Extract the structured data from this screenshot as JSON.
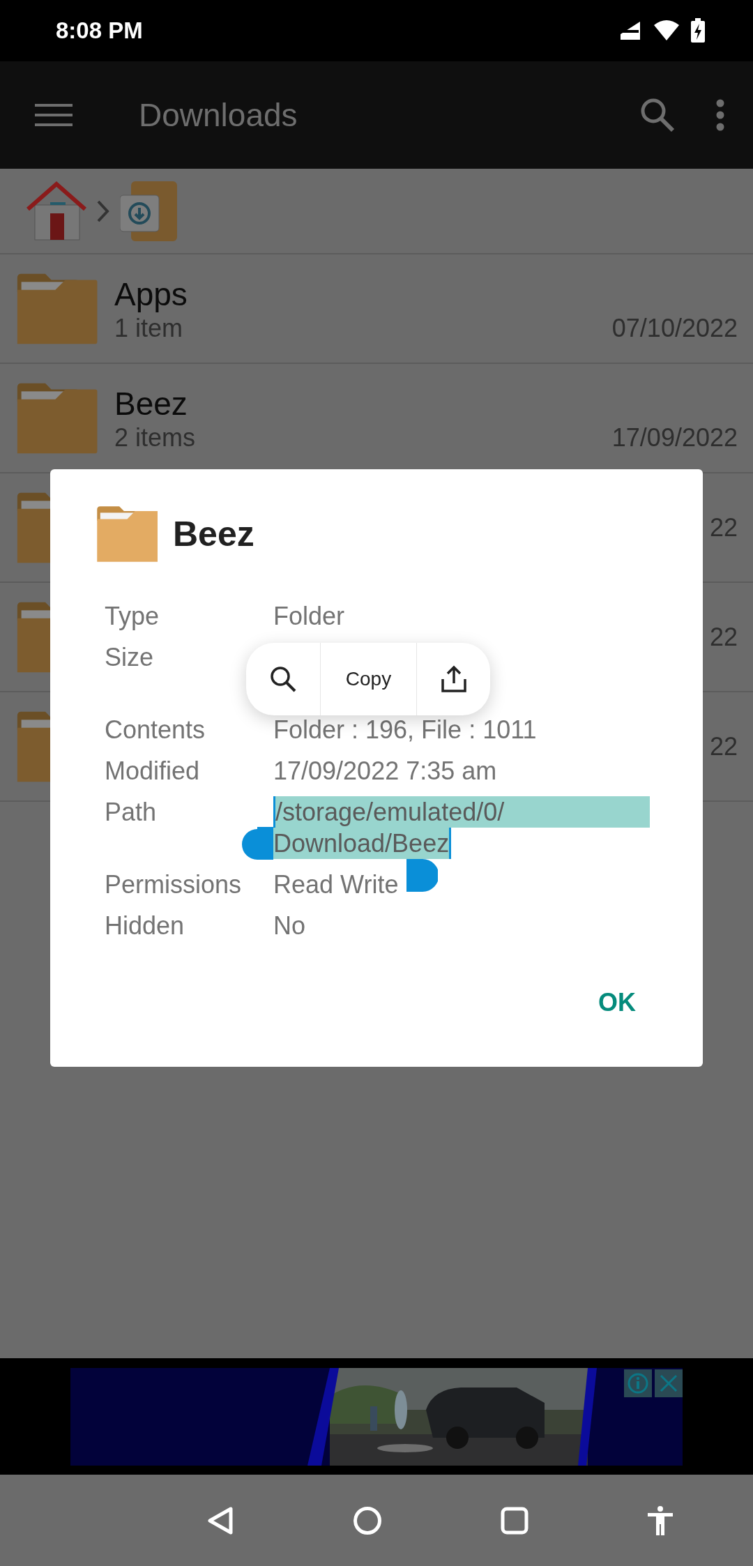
{
  "status_bar": {
    "time": "8:08 PM"
  },
  "app_bar": {
    "title": "Downloads"
  },
  "files": [
    {
      "name": "Apps",
      "details": "1 item",
      "date": "07/10/2022"
    },
    {
      "name": "Beez",
      "details": "2 items",
      "date": "17/09/2022"
    },
    {
      "date": "22"
    },
    {
      "date": "22"
    },
    {
      "date": "22"
    }
  ],
  "dialog": {
    "title": "Beez",
    "properties": [
      {
        "kind": "text",
        "label": "Type",
        "value": "Folder"
      },
      {
        "kind": "tall",
        "label": "Size"
      },
      {
        "kind": "text",
        "label": "Contents",
        "value": "Folder : 196, File : 1011"
      },
      {
        "kind": "text",
        "label": "Modified",
        "value": "17/09/2022 7:35 am"
      },
      {
        "kind": "path",
        "label": "Path",
        "lines": [
          "/storage/emulated/0/",
          "Download/Beez"
        ],
        "selected": true
      },
      {
        "kind": "text",
        "label": "Permissions",
        "value": "Read Write"
      },
      {
        "kind": "text",
        "label": "Hidden",
        "value": "No"
      }
    ],
    "button": "OK"
  },
  "selection_toolbar": {
    "action": "Copy"
  }
}
